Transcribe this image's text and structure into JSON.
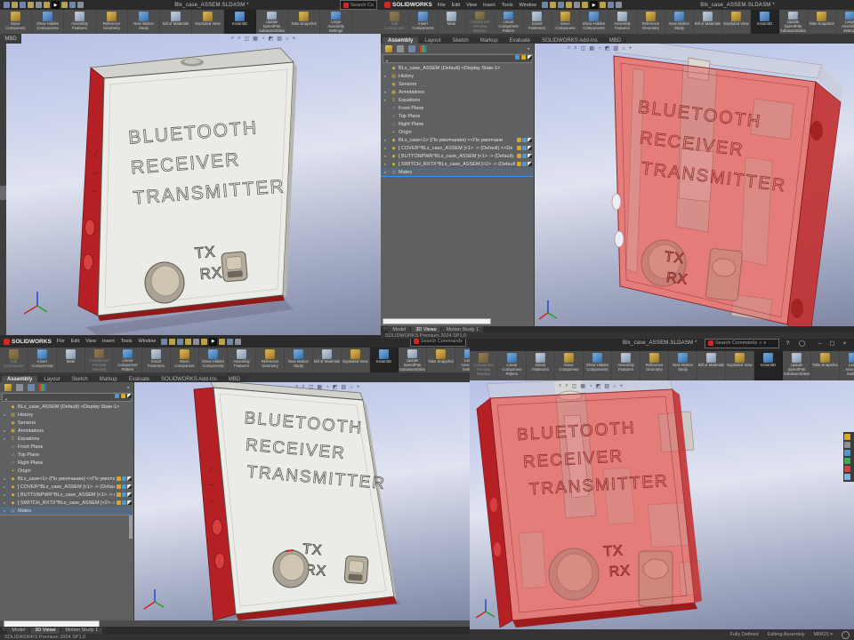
{
  "brand": {
    "name": "SOLIDWORKS"
  },
  "window": {
    "doc_title": "Blx_case_ASSEM.SLDASM *"
  },
  "search": {
    "commands_placeholder": "Search Commands",
    "commands_short": "Search Co"
  },
  "menus": [
    "File",
    "Edit",
    "View",
    "Insert",
    "Tools",
    "Window"
  ],
  "command_tabs": [
    "Assembly",
    "Layout",
    "Sketch",
    "Markup",
    "Evaluate",
    "SOLIDWORKS Add-Ins",
    "MBD"
  ],
  "mbd_tab_label": "MBD",
  "toolbars": {
    "full": [
      {
        "label": "Edit Component"
      },
      {
        "label": "Insert Components"
      },
      {
        "label": "Mate"
      },
      {
        "label": "Component Preview Window"
      },
      {
        "label": "Linear Component Pattern"
      },
      {
        "label": "Smart Fasteners"
      },
      {
        "label": "Move Component"
      },
      {
        "label": "Show Hidden Components"
      },
      {
        "label": "Assembly Features"
      },
      {
        "label": "Reference Geometry"
      },
      {
        "label": "New Motion Study"
      },
      {
        "label": "Bill of Materials"
      },
      {
        "label": "Exploded View"
      },
      {
        "label": "InstantID"
      },
      {
        "label": "Update SpeedPak Subassemblies"
      },
      {
        "label": "Take Snapshot"
      },
      {
        "label": "Large Assembly Settings"
      }
    ],
    "tail": [
      {
        "label": "Move Component"
      },
      {
        "label": "Show Hidden Components"
      },
      {
        "label": "Assembly Features"
      },
      {
        "label": "Reference Geometry"
      },
      {
        "label": "New Motion Study"
      },
      {
        "label": "Bill of Materials"
      },
      {
        "label": "Exploded View"
      },
      {
        "label": "InstantID"
      },
      {
        "label": "Update SpeedPak Subassemblies"
      },
      {
        "label": "Take Snapshot"
      },
      {
        "label": "Large Assembly Settings"
      }
    ],
    "br": [
      {
        "label": "Component Preview Window"
      },
      {
        "label": "Linear Component Pattern"
      },
      {
        "label": "Smart Fasteners"
      },
      {
        "label": "Move Component"
      },
      {
        "label": "Show Hidden Components"
      },
      {
        "label": "Assembly Features"
      },
      {
        "label": "Reference Geometry"
      },
      {
        "label": "New Motion Study"
      },
      {
        "label": "Bill of Materials"
      },
      {
        "label": "Exploded View"
      },
      {
        "label": "InstantID"
      },
      {
        "label": "Update SpeedPak Subassemblies"
      },
      {
        "label": "Take Snapshot"
      },
      {
        "label": "Large Assembly Settings"
      }
    ]
  },
  "feature_tree": {
    "root": "BLx_case_ASSEM (Default) <Display State-1>",
    "items": [
      {
        "arrow": "▸",
        "icon": "▤",
        "label": "History"
      },
      {
        "arrow": "",
        "icon": "◉",
        "label": "Sensors"
      },
      {
        "arrow": "▸",
        "icon": "▣",
        "label": "Annotations"
      },
      {
        "arrow": "▸",
        "icon": "Σ",
        "label": "Equations"
      },
      {
        "arrow": "",
        "icon": "▱",
        "label": "Front Plane"
      },
      {
        "arrow": "",
        "icon": "▱",
        "label": "Top Plane"
      },
      {
        "arrow": "",
        "icon": "▱",
        "label": "Right Plane"
      },
      {
        "arrow": "",
        "icon": "⌖",
        "label": "Origin"
      }
    ],
    "components": [
      {
        "arrow": "▸",
        "icon": "◆",
        "label": "BLx_case<1> (По умолчанию) <<По умолчани"
      },
      {
        "arrow": "▸",
        "icon": "◆",
        "label": "[ COVER^BLx_case_ASSEM ]<1> -> (Default) <<De"
      },
      {
        "arrow": "▸",
        "icon": "◆",
        "label": "[ BUTTONPWR^BLx_case_ASSEM ]<1> -> (Default) <<"
      },
      {
        "arrow": "▸",
        "icon": "◆",
        "label": "[ SWITCH_RXTX^BLx_case_ASSEM ]<2> -> (Default) <<"
      }
    ],
    "mates": "Mates"
  },
  "doc_tabs": [
    "Model",
    "3D Views",
    "Motion Study 1"
  ],
  "status": {
    "premium": "SOLIDWORKS Premium 2024 SP1.0",
    "fully_defined": "Fully Defined",
    "editing": "Editing Assembly",
    "units": "MMGS"
  },
  "model_text": {
    "line1": "BLUETOOTH",
    "line2": "RECEIVER",
    "line3": "TRANSMITTER",
    "tx": "TX",
    "rx": "RX"
  },
  "colors": {
    "case_red": "#b52025",
    "transparent_red": "#dd5a5a",
    "cover_gray": "#ebebe7",
    "button_beige": "#cfc6b2",
    "selection_blue": "#3b8fe8",
    "viewport_top": "#b7c1e6",
    "viewport_bottom": "#7e86a4"
  }
}
